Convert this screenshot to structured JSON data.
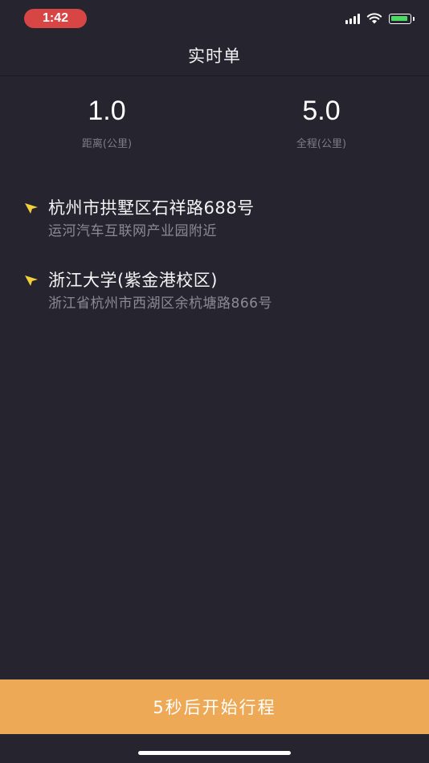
{
  "status_bar": {
    "time": "1:42",
    "time_pill_color": "#d84545",
    "icons": [
      "signal-icon",
      "wifi-icon",
      "battery-charging-icon"
    ]
  },
  "nav": {
    "title": "实时单"
  },
  "stats": [
    {
      "value": "1.0",
      "label": "距离(公里)"
    },
    {
      "value": "5.0",
      "label": "全程(公里)"
    }
  ],
  "route": {
    "start": {
      "title": "杭州市拱墅区石祥路688号",
      "subtitle": "运河汽车互联网产业园附近"
    },
    "end": {
      "title": "浙江大学(紫金港校区)",
      "subtitle": "浙江省杭州市西湖区余杭塘路866号"
    },
    "pin_color": "#f2cf3b"
  },
  "action": {
    "label": "5秒后开始行程",
    "color": "#eea956"
  }
}
